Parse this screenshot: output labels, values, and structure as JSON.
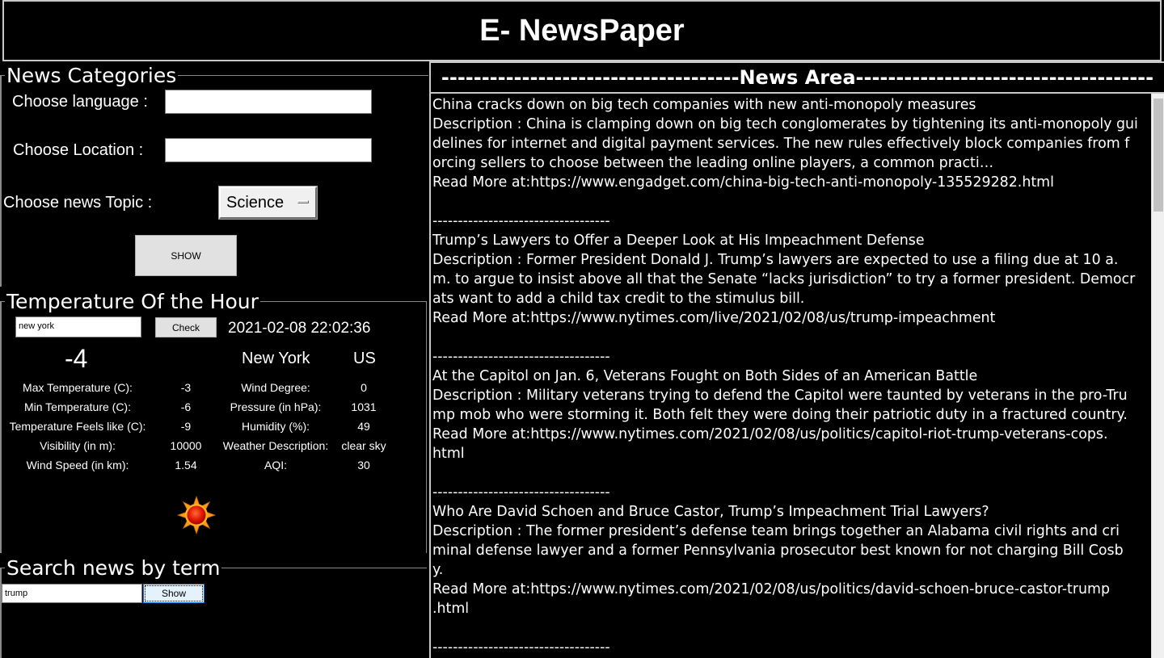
{
  "app": {
    "title": "E- NewsPaper"
  },
  "categories": {
    "legend": "News Categories",
    "language_label": "Choose language :",
    "language_value": "",
    "location_label": "Choose Location :",
    "location_value": "",
    "topic_label": "Choose news Topic :",
    "topic_value": "Science",
    "show_button": "SHOW"
  },
  "weather": {
    "legend": "Temperature Of the Hour",
    "city_input": "new york",
    "check_button": "Check",
    "datetime": "2021-02-08 22:02:36",
    "temperature": "-4",
    "city": "New York",
    "country": "US",
    "icon": "sun-icon",
    "rows": [
      {
        "label": "Max Temperature (C):",
        "value": "-3",
        "label2": "Wind Degree:",
        "value2": "0"
      },
      {
        "label": "Min Temperature (C):",
        "value": "-6",
        "label2": "Pressure (in hPa):",
        "value2": "1031"
      },
      {
        "label": "Temperature Feels like (C):",
        "value": "-9",
        "label2": "Humidity (%):",
        "value2": "49"
      },
      {
        "label": "Visibility (in m):",
        "value": "10000",
        "label2": "Weather Description:",
        "value2": "clear sky"
      },
      {
        "label": "Wind Speed (in km):",
        "value": "1.54",
        "label2": "AQI:",
        "value2": "30"
      }
    ]
  },
  "search": {
    "legend": "Search news by term",
    "term_value": "trump",
    "show_button": "Show"
  },
  "news": {
    "header": "-------------------------------------News Area-------------------------------------",
    "separator": "-----------------------------------",
    "items": [
      {
        "lines": [
          "China cracks down on big tech companies with new anti-monopoly measures",
          "Description : China is clamping down on big tech conglomerates by tightening its anti-monopoly gui",
          "delines for internet and digital payment services. The new rules effectively block companies from f",
          "orcing sellers to choose between the leading online players, a common practi…",
          "Read More at:https://www.engadget.com/china-big-tech-anti-monopoly-135529282.html"
        ]
      },
      {
        "lines": [
          "Trump’s Lawyers to Offer a Deeper Look at His Impeachment Defense",
          "Description : Former President Donald J. Trump’s lawyers are expected to use a filing due at 10 a.",
          "m. to argue to insist above all that the Senate “lacks jurisdiction” to try a former president. Democr",
          "ats want to add a child tax credit to the stimulus bill.",
          "Read More at:https://www.nytimes.com/live/2021/02/08/us/trump-impeachment"
        ]
      },
      {
        "lines": [
          "At the Capitol on Jan. 6, Veterans Fought on Both Sides of an American Battle",
          "Description : Military veterans trying to defend the Capitol were taunted by veterans in the pro-Tru",
          "mp mob who were storming it. Both felt they were doing their patriotic duty in a fractured country.",
          "Read More at:https://www.nytimes.com/2021/02/08/us/politics/capitol-riot-trump-veterans-cops.",
          "html"
        ]
      },
      {
        "lines": [
          "Who Are David Schoen and Bruce Castor, Trump’s Impeachment Trial Lawyers?",
          "Description : The former president’s defense team brings together an Alabama civil rights and cri",
          "minal defense lawyer and a former Pennsylvania prosecutor best known for not charging Bill Cosb",
          "y.",
          "Read More at:https://www.nytimes.com/2021/02/08/us/politics/david-schoen-bruce-castor-trump",
          ".html"
        ]
      }
    ]
  }
}
